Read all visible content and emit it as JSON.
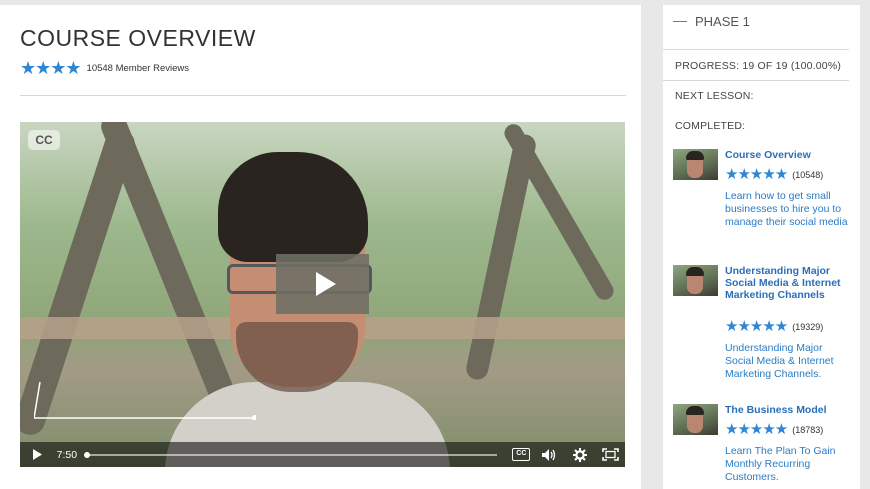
{
  "course": {
    "title": "COURSE OVERVIEW",
    "stars": "★★★★",
    "review_count": "10548 Member Reviews"
  },
  "video": {
    "cc_badge": "CC",
    "time": "7:50",
    "progress": 0,
    "controls": {
      "play_icon": "play-icon",
      "cc_icon": "closed-captions-icon",
      "volume_icon": "volume-icon",
      "settings_icon": "gear-icon",
      "fullscreen_icon": "fullscreen-icon",
      "cc_label": "CC"
    }
  },
  "sidebar": {
    "phase": "PHASE 1",
    "progress": "PROGRESS: 19 OF 19 (100.00%)",
    "next_lesson": "NEXT LESSON:",
    "completed": "COMPLETED:",
    "lessons": [
      {
        "title": "Course Overview",
        "stars": "★★★★★",
        "count": "(10548)",
        "desc": "Learn how to get small businesses to hire you to manage their social media"
      },
      {
        "title": "Understanding Major Social Media & Internet Marketing Channels",
        "stars": "★★★★★",
        "count": "(19329)",
        "desc": "Understanding Major Social Media & Internet Marketing Channels."
      },
      {
        "title": "The Business Model",
        "stars": "★★★★★",
        "count": "(18783)",
        "desc": "Learn The Plan To Gain Monthly Recurring Customers."
      }
    ]
  },
  "colors": {
    "accent": "#2f86d4",
    "link": "#2a6fb8"
  }
}
